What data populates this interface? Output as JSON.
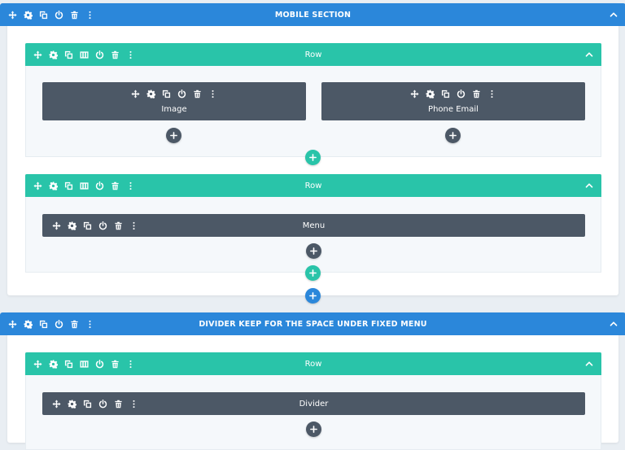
{
  "sections": [
    {
      "title": "MOBILE SECTION",
      "rows": [
        {
          "title": "Row",
          "modules": [
            {
              "title": "Image"
            },
            {
              "title": "Phone Email"
            }
          ]
        },
        {
          "title": "Row",
          "modules": [
            {
              "title": "Menu"
            }
          ]
        }
      ]
    },
    {
      "title": "DIVIDER KEEP FOR THE SPACE UNDER FIXED MENU",
      "rows": [
        {
          "title": "Row",
          "modules": [
            {
              "title": "Divider"
            }
          ]
        }
      ]
    }
  ],
  "colors": {
    "section_bar": "#2b87da",
    "row_bar": "#29c4a9",
    "module": "#4c5866",
    "canvas": "#e9eef3"
  },
  "icons": {
    "section_toolbar": [
      "move-icon",
      "gear-icon",
      "duplicate-icon",
      "power-icon",
      "trash-icon",
      "more-icon"
    ],
    "row_toolbar": [
      "move-icon",
      "gear-icon",
      "duplicate-icon",
      "columns-icon",
      "power-icon",
      "trash-icon",
      "more-icon"
    ],
    "module_toolbar": [
      "move-icon",
      "gear-icon",
      "duplicate-icon",
      "power-icon",
      "trash-icon",
      "more-icon"
    ],
    "collapse": "chevron-up-icon",
    "add": "plus-icon"
  }
}
